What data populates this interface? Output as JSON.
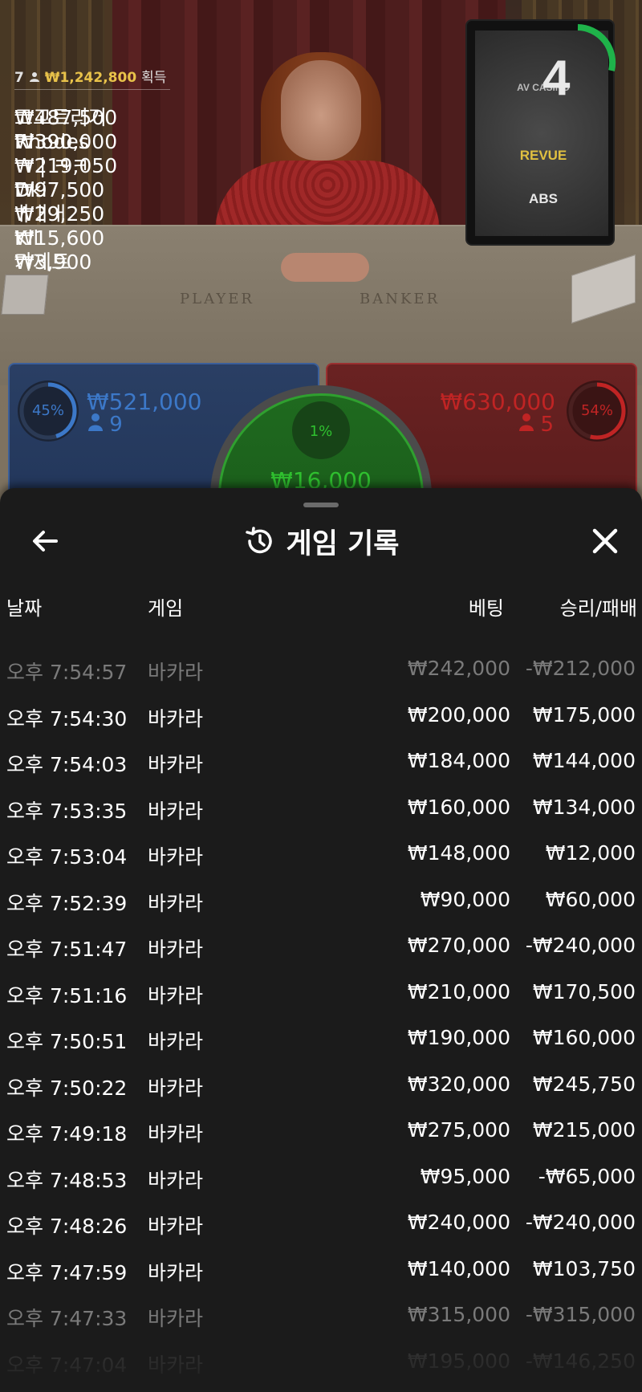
{
  "leaderboard": {
    "winners_count": "7",
    "total_amount": "₩1,242,800",
    "total_label": "획득",
    "entries": [
      {
        "amount": "₩487,500",
        "name": "고고트리거"
      },
      {
        "amount": "₩390,000",
        "name": "Rhodes"
      },
      {
        "amount": "₩219,050",
        "name": "ㅋ | ㅋㅋ"
      },
      {
        "amount": "₩97,500",
        "name": "Dki"
      },
      {
        "amount": "₩29,250",
        "name": "ㅐㅐㅐ"
      },
      {
        "amount": "₩15,600",
        "name": "Kll"
      },
      {
        "amount": "₩3,900",
        "name": "가제트"
      }
    ]
  },
  "video": {
    "table_player": "PLAYER",
    "table_banker": "BANKER",
    "monitor_logos": [
      "AV CASINO",
      "REVUE",
      "ABS"
    ],
    "round_countdown": "4"
  },
  "bets": {
    "player": {
      "percent_text": "45%",
      "percent": 45,
      "amount": "₩521,000",
      "players": "9",
      "color": "#3c78c8"
    },
    "banker": {
      "percent_text": "54%",
      "percent": 54,
      "amount": "₩630,000",
      "players": "5",
      "color": "#c02424"
    },
    "tie": {
      "percent_text": "1%",
      "percent": 1,
      "amount": "₩16,000",
      "color": "#2fc02f"
    }
  },
  "history": {
    "title": "게임 기록",
    "columns": {
      "date": "날짜",
      "game": "게임",
      "bet": "베팅",
      "result": "승리/패배"
    },
    "rows": [
      {
        "time": "오후 7:54:57",
        "game": "바카라",
        "bet": "₩242,000",
        "result": "-₩212,000"
      },
      {
        "time": "오후 7:54:30",
        "game": "바카라",
        "bet": "₩200,000",
        "result": "₩175,000"
      },
      {
        "time": "오후 7:54:03",
        "game": "바카라",
        "bet": "₩184,000",
        "result": "₩144,000"
      },
      {
        "time": "오후 7:53:35",
        "game": "바카라",
        "bet": "₩160,000",
        "result": "₩134,000"
      },
      {
        "time": "오후 7:53:04",
        "game": "바카라",
        "bet": "₩148,000",
        "result": "₩12,000"
      },
      {
        "time": "오후 7:52:39",
        "game": "바카라",
        "bet": "₩90,000",
        "result": "₩60,000"
      },
      {
        "time": "오후 7:51:47",
        "game": "바카라",
        "bet": "₩270,000",
        "result": "-₩240,000"
      },
      {
        "time": "오후 7:51:16",
        "game": "바카라",
        "bet": "₩210,000",
        "result": "₩170,500"
      },
      {
        "time": "오후 7:50:51",
        "game": "바카라",
        "bet": "₩190,000",
        "result": "₩160,000"
      },
      {
        "time": "오후 7:50:22",
        "game": "바카라",
        "bet": "₩320,000",
        "result": "₩245,750"
      },
      {
        "time": "오후 7:49:18",
        "game": "바카라",
        "bet": "₩275,000",
        "result": "₩215,000"
      },
      {
        "time": "오후 7:48:53",
        "game": "바카라",
        "bet": "₩95,000",
        "result": "-₩65,000"
      },
      {
        "time": "오후 7:48:26",
        "game": "바카라",
        "bet": "₩240,000",
        "result": "-₩240,000"
      },
      {
        "time": "오후 7:47:59",
        "game": "바카라",
        "bet": "₩140,000",
        "result": "₩103,750"
      },
      {
        "time": "오후 7:47:33",
        "game": "바카라",
        "bet": "₩315,000",
        "result": "-₩315,000"
      },
      {
        "time": "오후 7:47:04",
        "game": "바카라",
        "bet": "₩195,000",
        "result": "-₩146,250"
      }
    ]
  },
  "icons": {
    "back": "arrow-left-icon",
    "close": "close-icon",
    "history": "history-clock-icon",
    "person": "person-icon"
  }
}
